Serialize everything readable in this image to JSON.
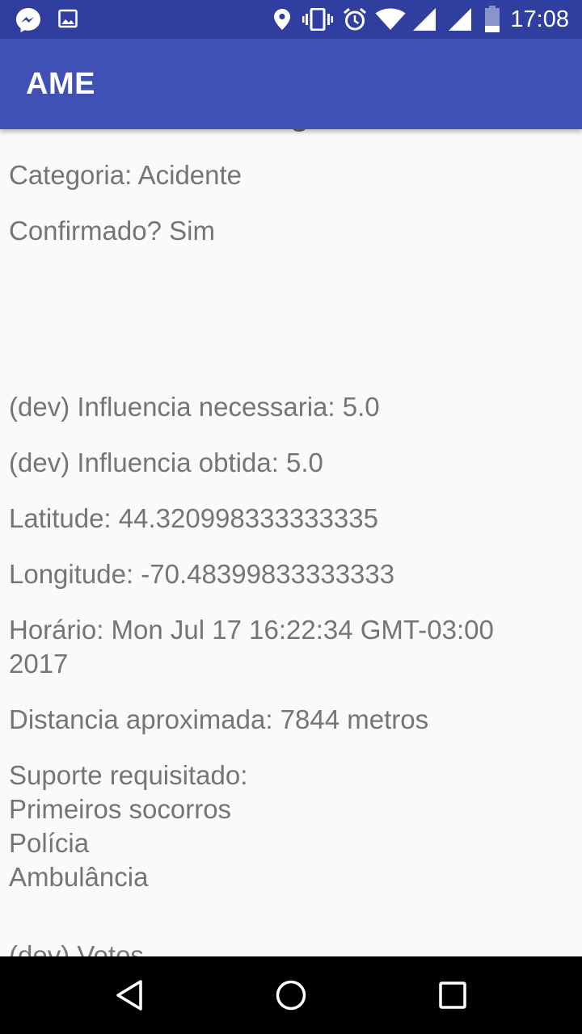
{
  "status_bar": {
    "time": "17:08",
    "left_icons": [
      "messenger-icon",
      "image-icon"
    ],
    "right_icons": [
      "location-icon",
      "vibrate-icon",
      "alarm-icon",
      "wifi-icon",
      "signal-icon",
      "signal-icon",
      "battery-icon"
    ]
  },
  "app_bar": {
    "title": "AME"
  },
  "details": {
    "section_title": "Detalhes da emergencia",
    "category": "Categoria: Acidente",
    "confirmed": "Confirmado? Sim",
    "influence_needed": "(dev) Influencia necessaria: 5.0",
    "influence_obtained": "(dev) Influencia obtida: 5.0",
    "latitude": "Latitude: 44.320998333333335",
    "longitude": "Longitude: -70.48399833333333",
    "time": "Horário: Mon Jul 17 16:22:34 GMT-03:00\n2017",
    "distance": "Distancia aproximada: 7844 metros",
    "support": "Suporte requisitado:\nPrimeiros socorros\nPolícia\nAmbulância",
    "votes_partial": "(dev) Votos"
  },
  "nav_bar": {
    "buttons": [
      "back",
      "home",
      "recents"
    ]
  }
}
